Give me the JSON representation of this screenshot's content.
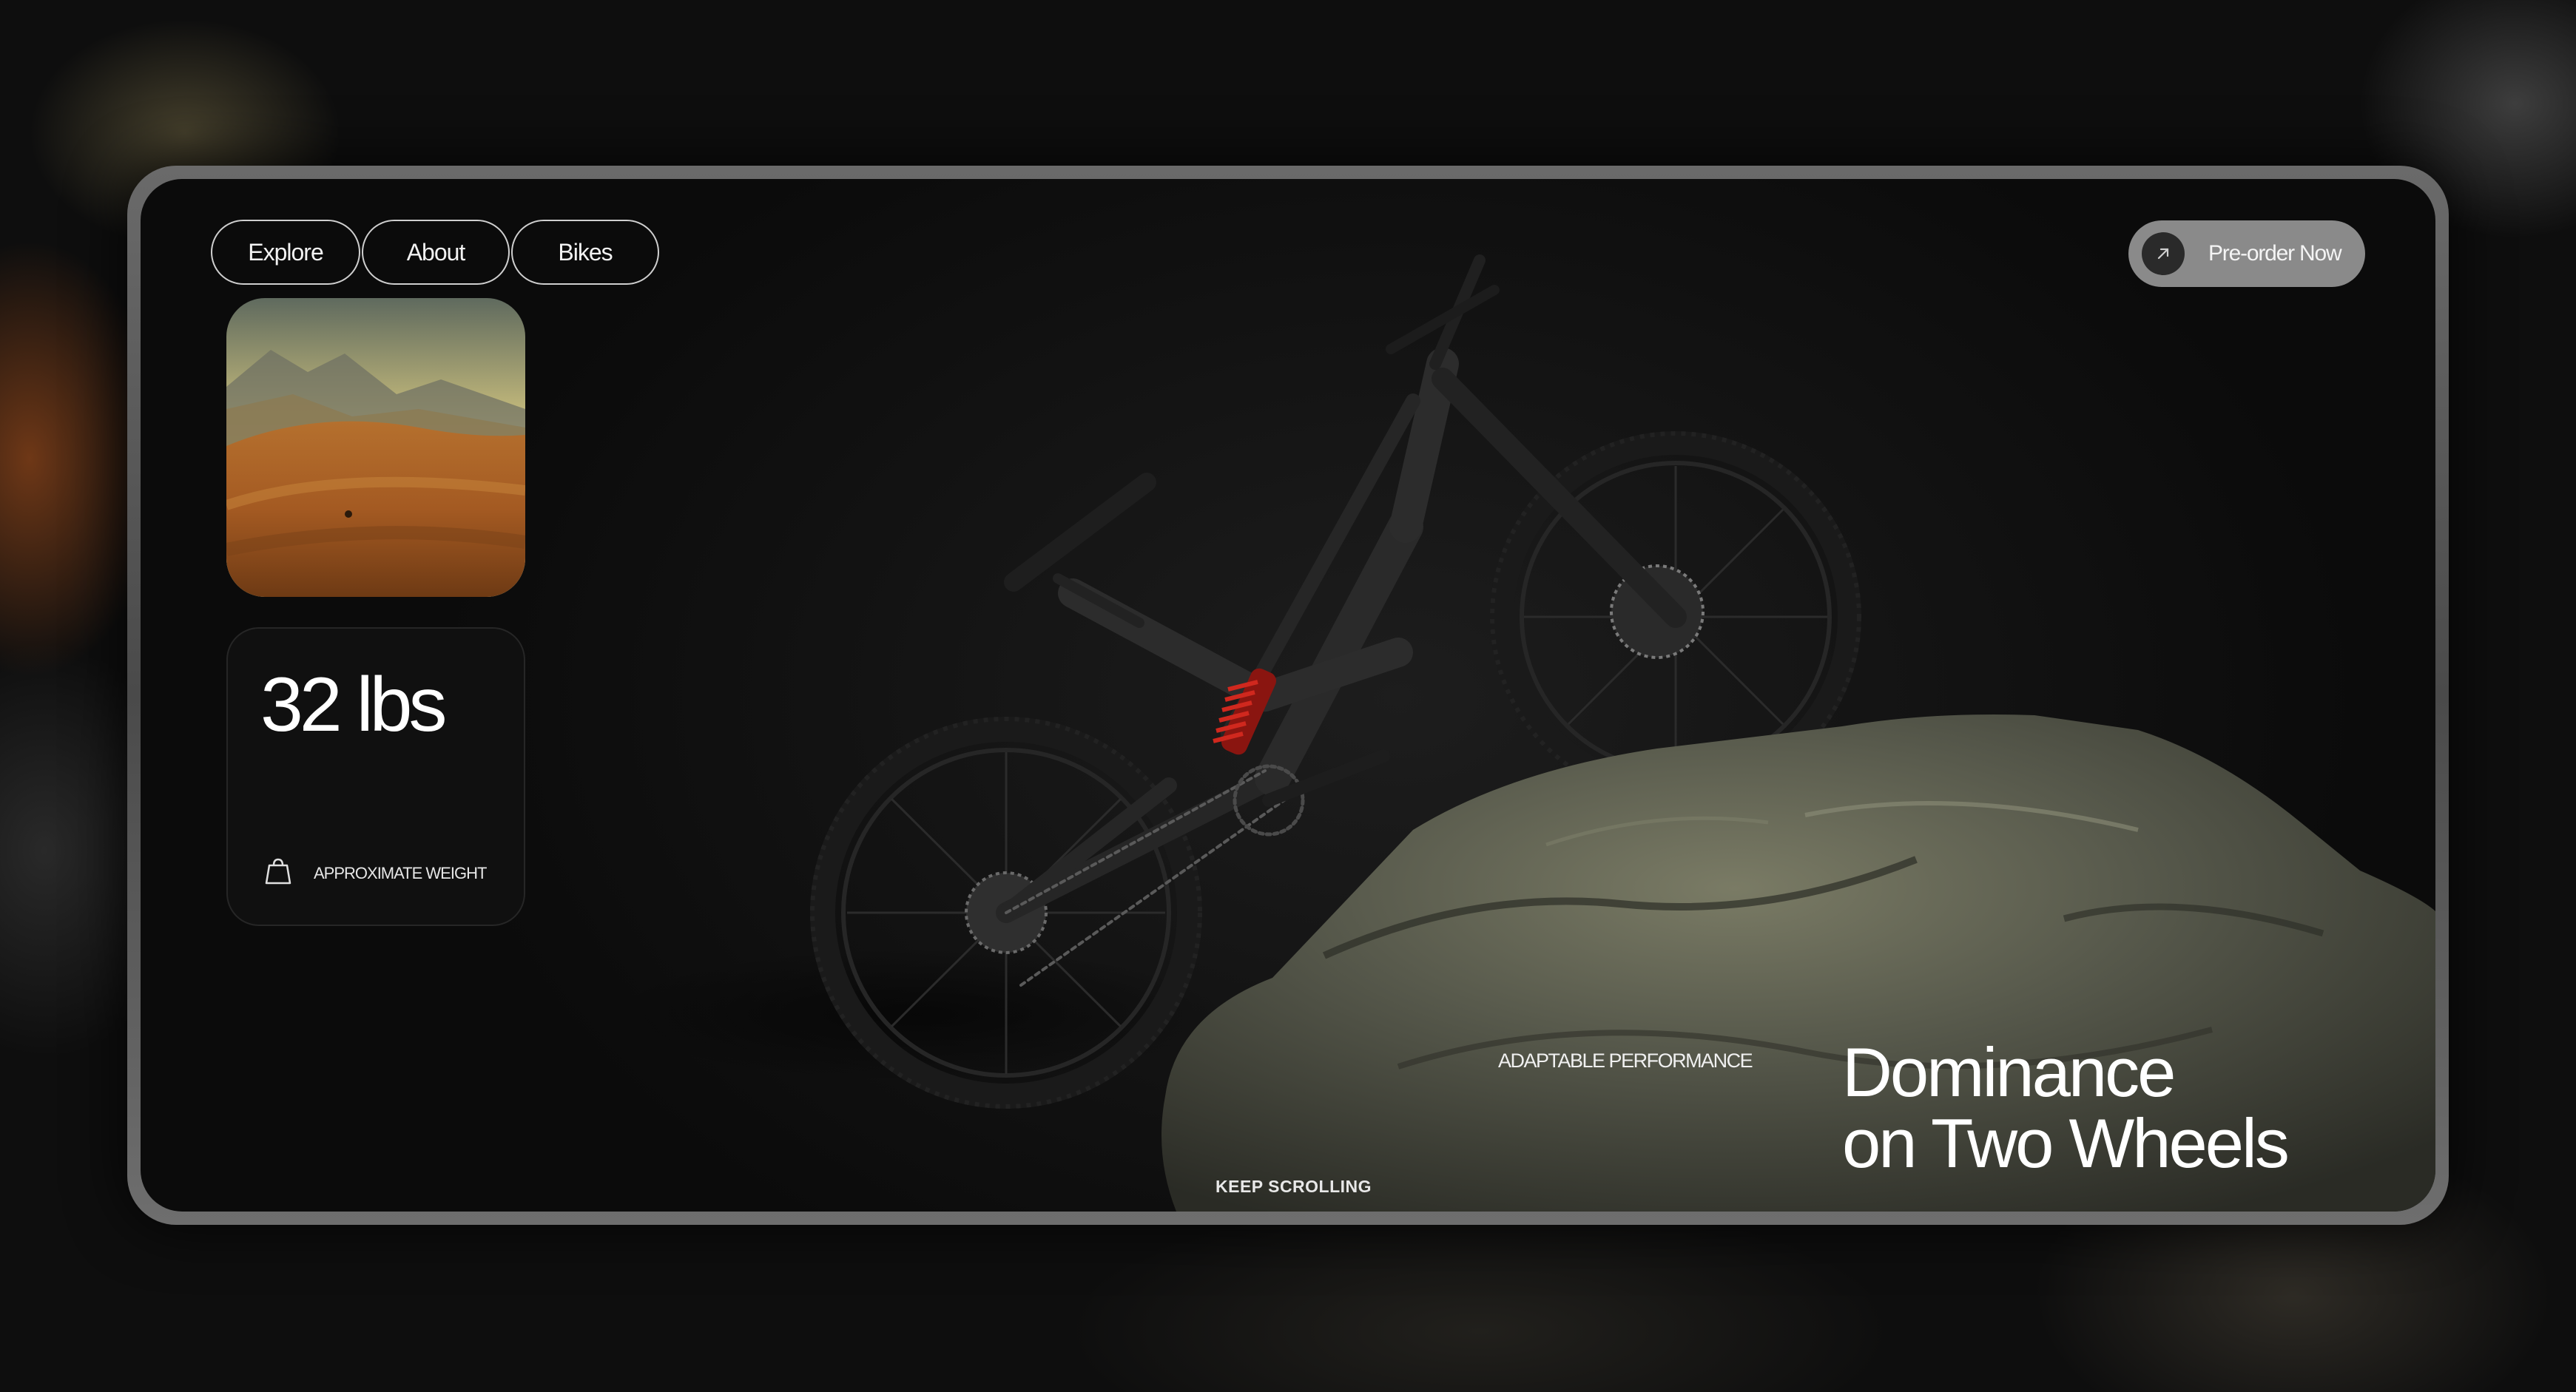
{
  "nav": {
    "items": [
      "Explore",
      "About",
      "Bikes"
    ]
  },
  "cta": {
    "label": "Pre-order Now",
    "icon": "arrow-up-right-icon"
  },
  "stats": {
    "weight_value": "32 lbs",
    "weight_label": "APPROXIMATE WEIGHT",
    "weight_icon": "weight-icon"
  },
  "hero": {
    "tagline": "ADAPTABLE PERFORMANCE",
    "headline_line1": "Dominance",
    "headline_line2": "on Two Wheels",
    "scroll_hint": "KEEP SCROLLING"
  },
  "colors": {
    "accent_red": "#c0201a",
    "background": "#121212",
    "cta_bg": "#8a8a8a"
  }
}
